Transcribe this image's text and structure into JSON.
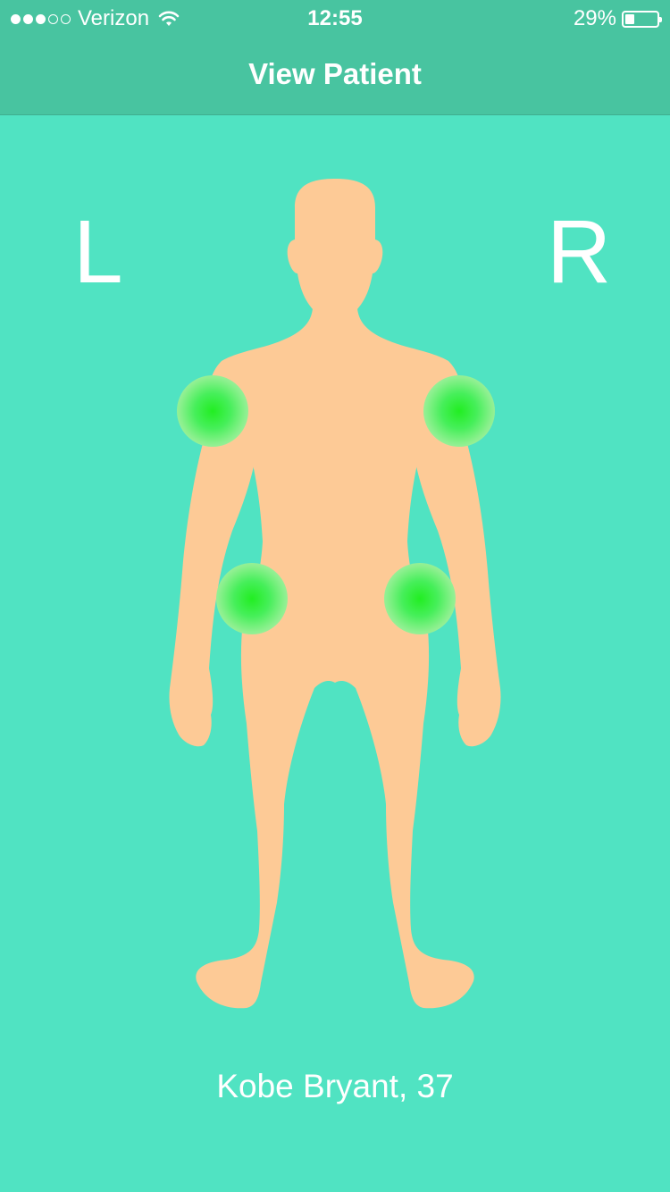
{
  "status_bar": {
    "carrier": "Verizon",
    "time": "12:55",
    "battery_percent": "29%",
    "battery_level": 0.29,
    "signal_bars_filled": 3,
    "signal_bars_total": 5
  },
  "nav": {
    "title": "View Patient"
  },
  "orientation": {
    "left_label": "L",
    "right_label": "R"
  },
  "joints": [
    {
      "id": "left-shoulder"
    },
    {
      "id": "right-shoulder"
    },
    {
      "id": "left-hip"
    },
    {
      "id": "right-hip"
    }
  ],
  "patient": {
    "label": "Kobe Bryant, 37"
  },
  "colors": {
    "background": "#50e3c2",
    "header": "#48c4a0",
    "skin": "#fdca96",
    "joint_center": "#22ee22"
  }
}
